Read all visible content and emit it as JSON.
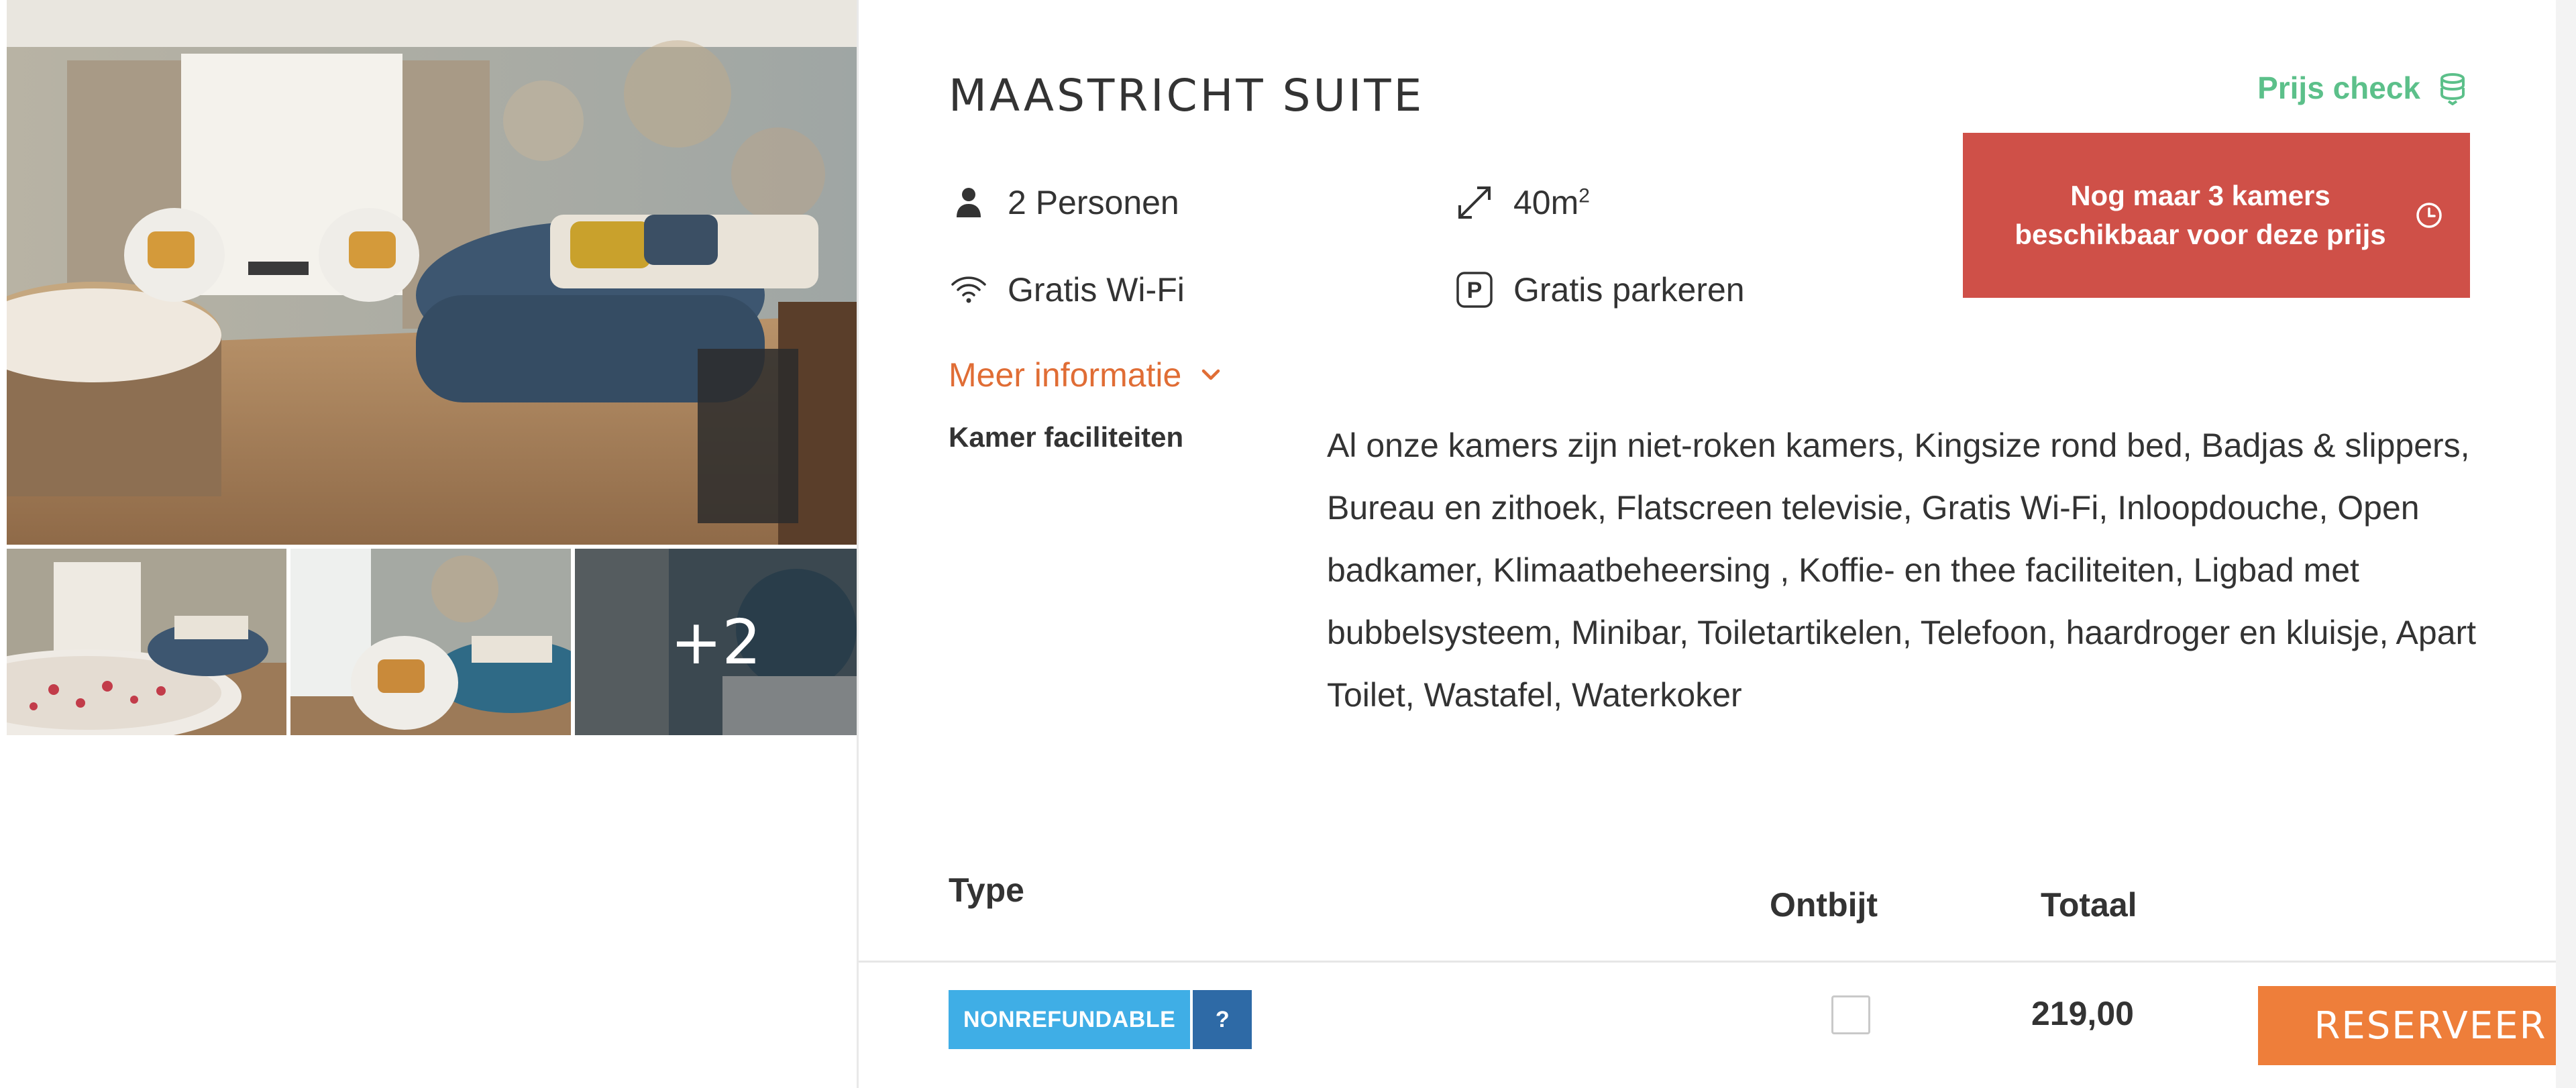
{
  "gallery": {
    "main_photo_icon": "suite-photo",
    "thumbnails": [
      "bath-with-petals-photo",
      "lounge-chair-photo",
      "bathroom-photo"
    ],
    "more_count": "+2"
  },
  "room": {
    "title": "MAASTRICHT SUITE",
    "price_check_label": "Prijs check",
    "alert_text": "Nog maar 3 kamers beschikbaar voor deze prijs",
    "features": {
      "persons": "2 Personen",
      "size_value": "40m",
      "size_unit_sup": "2",
      "wifi": "Gratis Wi-Fi",
      "parking": "Gratis parkeren"
    },
    "more_info_label": "Meer informatie",
    "facilities_label": "Kamer faciliteiten",
    "facilities_text": "Al onze kamers zijn niet-roken kamers, Kingsize rond bed, Badjas & slippers, Bureau en zithoek, Flatscreen televisie, Gratis Wi-Fi, Inloopdouche, Open badkamer, Klimaatbeheersing , Koffie- en thee faciliteiten, Ligbad met bubbelsysteem, Minibar, Toiletartikelen, Telefoon, haardroger en kluisje, Apart Toilet, Wastafel, Waterkoker"
  },
  "rates_table": {
    "headers": {
      "type": "Type",
      "breakfast": "Ontbijt",
      "total": "Totaal"
    },
    "rows": [
      {
        "rate_name": "NONREFUNDABLE",
        "info_label": "?",
        "breakfast_checked": false,
        "total": "219,00",
        "button_label": "RESERVEER"
      }
    ]
  },
  "colors": {
    "accent_orange": "#ee7e3a",
    "link_orange": "#e06d35",
    "alert_red": "#cf5048",
    "price_check_green": "#5cc08a",
    "badge_blue": "#3faee6",
    "badge_dark_blue": "#2e6aa6"
  }
}
